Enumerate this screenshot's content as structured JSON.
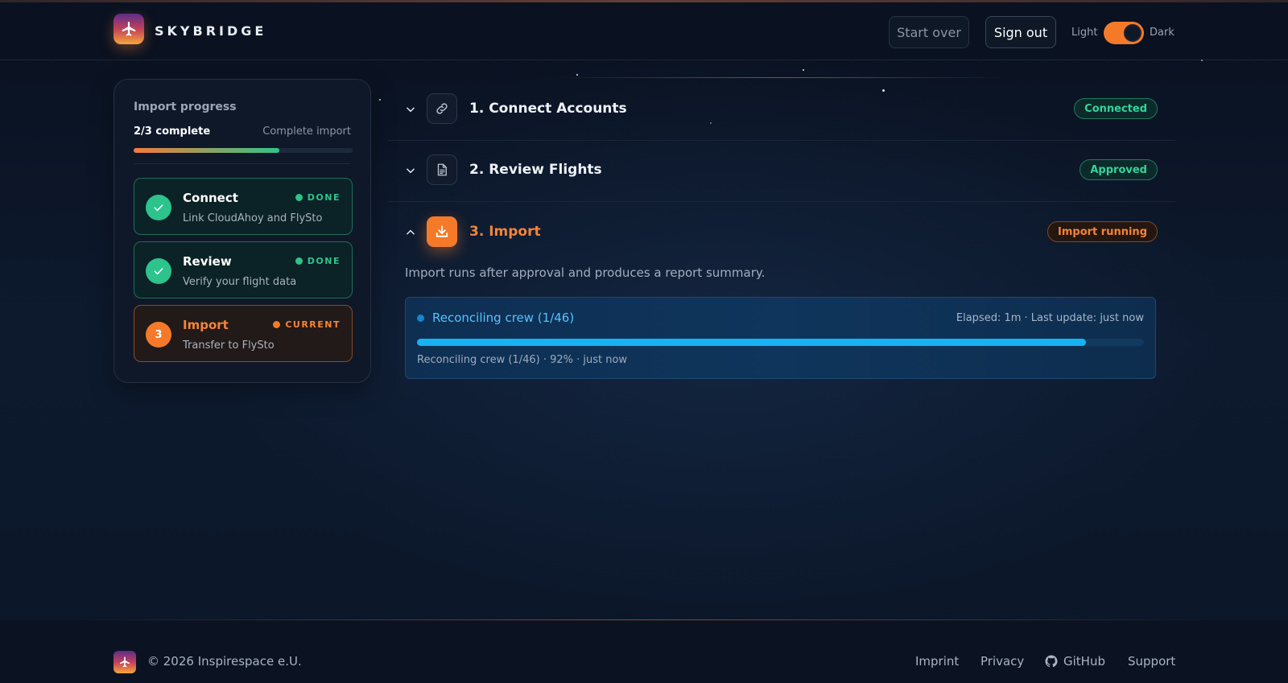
{
  "brand": {
    "name": "SKYBRIDGE"
  },
  "header": {
    "start_over": "Start over",
    "sign_out": "Sign out",
    "theme_light": "Light",
    "theme_dark": "Dark",
    "theme_toggle_on": true
  },
  "sidebar": {
    "title": "Import progress",
    "count": "2/3 complete",
    "complete_link": "Complete import",
    "progress_fraction": 0.667,
    "steps": [
      {
        "name": "Connect",
        "desc": "Link CloudAhoy and FlySto",
        "tag": "DONE",
        "status": "done",
        "icon": "check-icon"
      },
      {
        "name": "Review",
        "desc": "Verify your flight data",
        "tag": "DONE",
        "status": "done",
        "icon": "check-icon"
      },
      {
        "name": "Import",
        "desc": "Transfer to FlySto",
        "tag": "CURRENT",
        "status": "current",
        "number": "3"
      }
    ]
  },
  "main": {
    "sections": [
      {
        "title": "1. Connect Accounts",
        "status": "Connected",
        "icon": "link-icon",
        "expanded": false
      },
      {
        "title": "2. Review Flights",
        "status": "Approved",
        "icon": "document-icon",
        "expanded": false
      },
      {
        "title": "3. Import",
        "status": "Import running",
        "icon": "download-icon",
        "expanded": true
      }
    ],
    "import_desc": "Import runs after approval and produces a report summary.",
    "job": {
      "title": "Reconciling crew (1/46)",
      "meta": "Elapsed: 1m · Last update: just now",
      "progress_percent": 92,
      "subtitle": "Reconciling crew (1/46) · 92% · just now"
    }
  },
  "footer": {
    "copyright": "© 2026 Inspirespace e.U.",
    "links": [
      "Imprint",
      "Privacy",
      "GitHub",
      "Support"
    ]
  },
  "colors": {
    "accent_orange": "#f47a2a",
    "success_green": "#2dc38c",
    "info_blue": "#17b2f2",
    "background": "#0b1424"
  }
}
